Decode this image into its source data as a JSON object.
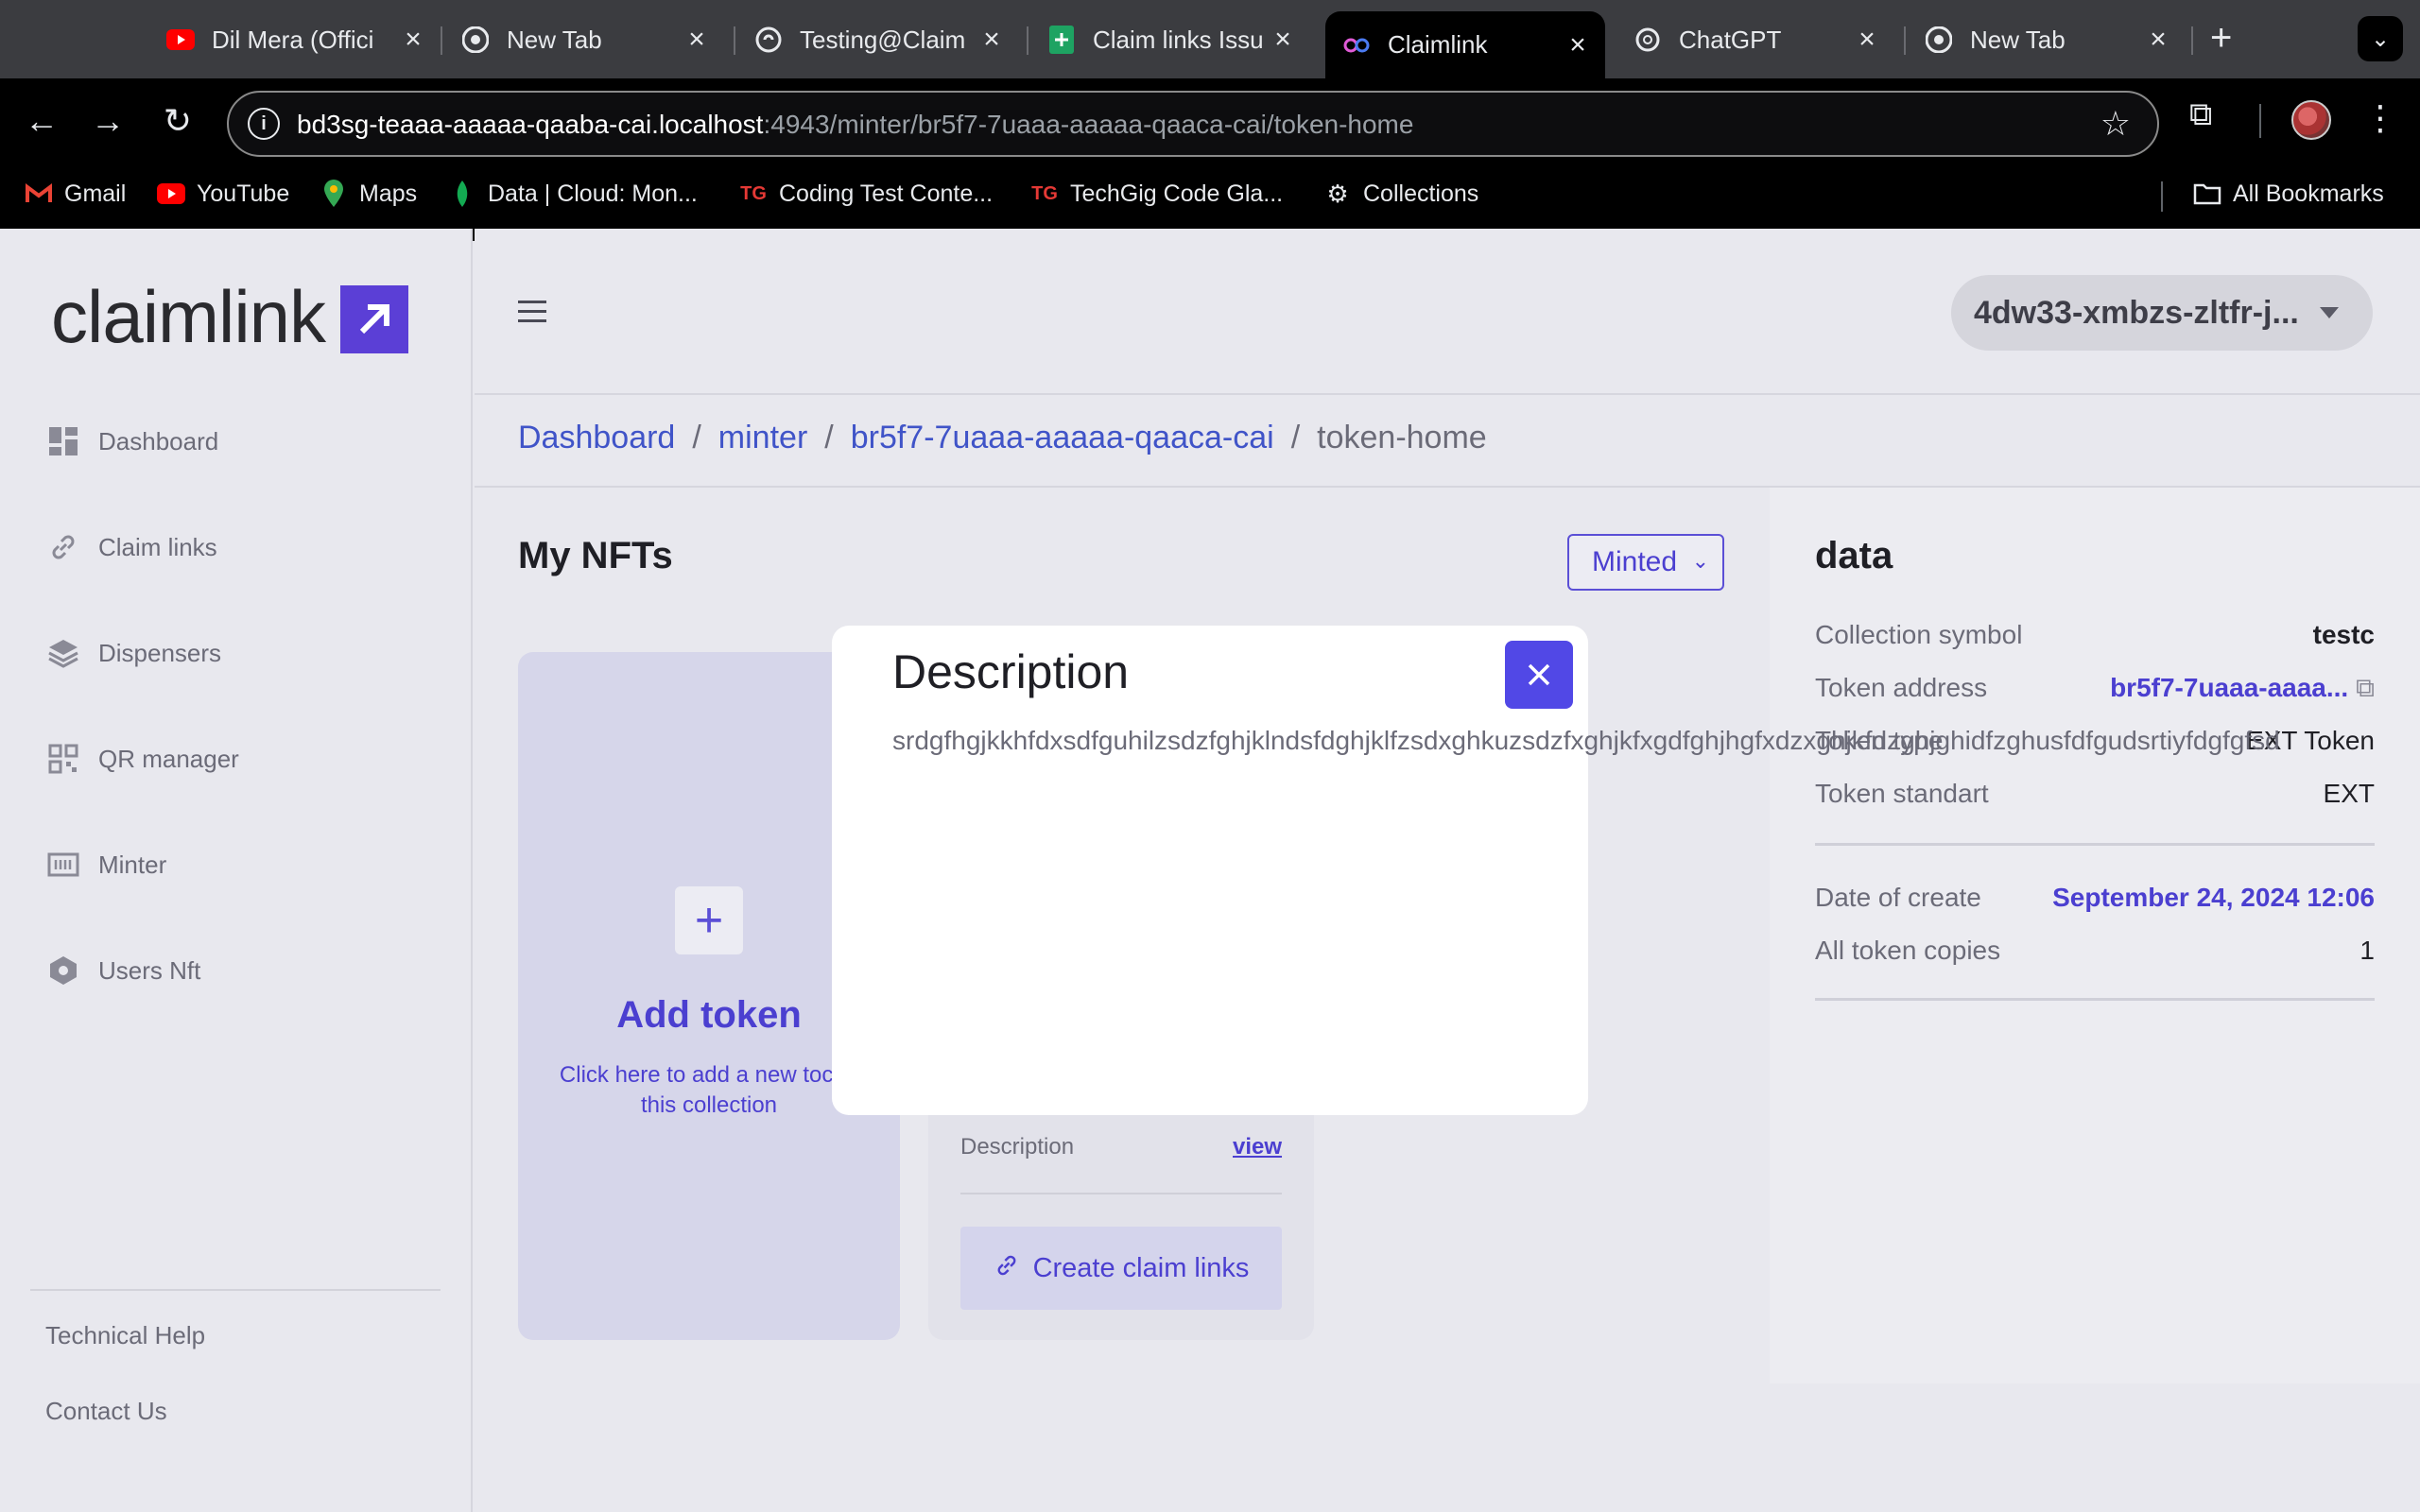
{
  "browser": {
    "tabs": [
      {
        "title": "Dil Mera (Offici",
        "icon": "youtube-icon"
      },
      {
        "title": "New Tab",
        "icon": "chrome-icon"
      },
      {
        "title": "Testing@Claim",
        "icon": "web-icon"
      },
      {
        "title": "Claim links Issu",
        "icon": "sheets-icon"
      },
      {
        "title": "Claimlink",
        "icon": "claimlink-icon",
        "active": true
      },
      {
        "title": "ChatGPT",
        "icon": "openai-icon"
      },
      {
        "title": "New Tab",
        "icon": "chrome-icon"
      }
    ],
    "url": {
      "host": "bd3sg-teaaa-aaaaa-qaaba-cai.localhost",
      "rest": ":4943/minter/br5f7-7uaaa-aaaaa-qaaca-cai/token-home"
    },
    "bookmarks": [
      {
        "label": "Gmail",
        "icon": "gmail-icon"
      },
      {
        "label": "YouTube",
        "icon": "youtube-icon"
      },
      {
        "label": "Maps",
        "icon": "maps-icon"
      },
      {
        "label": "Data | Cloud: Mon...",
        "icon": "mongodb-icon"
      },
      {
        "label": "Coding Test Conte...",
        "icon": "techgig-icon"
      },
      {
        "label": "TechGig Code Gla...",
        "icon": "techgig-icon"
      },
      {
        "label": "Collections",
        "icon": "gear-icon"
      }
    ],
    "all_bookmarks": "All Bookmarks"
  },
  "app": {
    "logo_text": "claimlink",
    "nav": [
      {
        "label": "Dashboard",
        "icon": "dashboard-icon"
      },
      {
        "label": "Claim links",
        "icon": "link-icon"
      },
      {
        "label": "Dispensers",
        "icon": "layers-icon"
      },
      {
        "label": "QR manager",
        "icon": "qr-icon"
      },
      {
        "label": "Minter",
        "icon": "minter-icon"
      },
      {
        "label": "Users Nft",
        "icon": "hexagon-icon"
      }
    ],
    "footer_links": [
      "Technical Help",
      "Contact Us"
    ],
    "principal": "4dw33-xmbzs-zltfr-j...",
    "breadcrumb": [
      "Dashboard",
      "minter",
      "br5f7-7uaaa-aaaaa-qaaca-cai",
      "token-home"
    ],
    "my_nfts": "My NFTs",
    "filter_value": "Minted",
    "add_token": {
      "title": "Add token",
      "text": "Click here to add a new toc to this collection"
    },
    "token_card": {
      "description_label": "Description",
      "view_label": "view",
      "claim_button": "Create claim links"
    },
    "data_panel": {
      "title": "data",
      "rows": [
        {
          "key": "Collection symbol",
          "value": "testc"
        },
        {
          "key": "Token address",
          "value": "br5f7-7uaaa-aaaa..."
        },
        {
          "key": "Token type",
          "value": "EXT Token"
        },
        {
          "key": "Token standart",
          "value": "EXT"
        },
        {
          "key": "Date of create",
          "value": "September 24, 2024 12:06"
        },
        {
          "key": "All token copies",
          "value": "1"
        }
      ]
    }
  },
  "modal": {
    "title": "Description",
    "body": "srdgfhgjkkhfdxsdfguhilzsdzfghjklndsfdghjklfzsdxghkuzsdzfxghjkfxgdfghjhgfxdzxghjkfdzghjghidfzghusfdfgudsrtiyfdgfgfsd"
  },
  "colors": {
    "accent": "#5148e6",
    "link": "#4054c8",
    "brand": "#5b3fd6"
  }
}
